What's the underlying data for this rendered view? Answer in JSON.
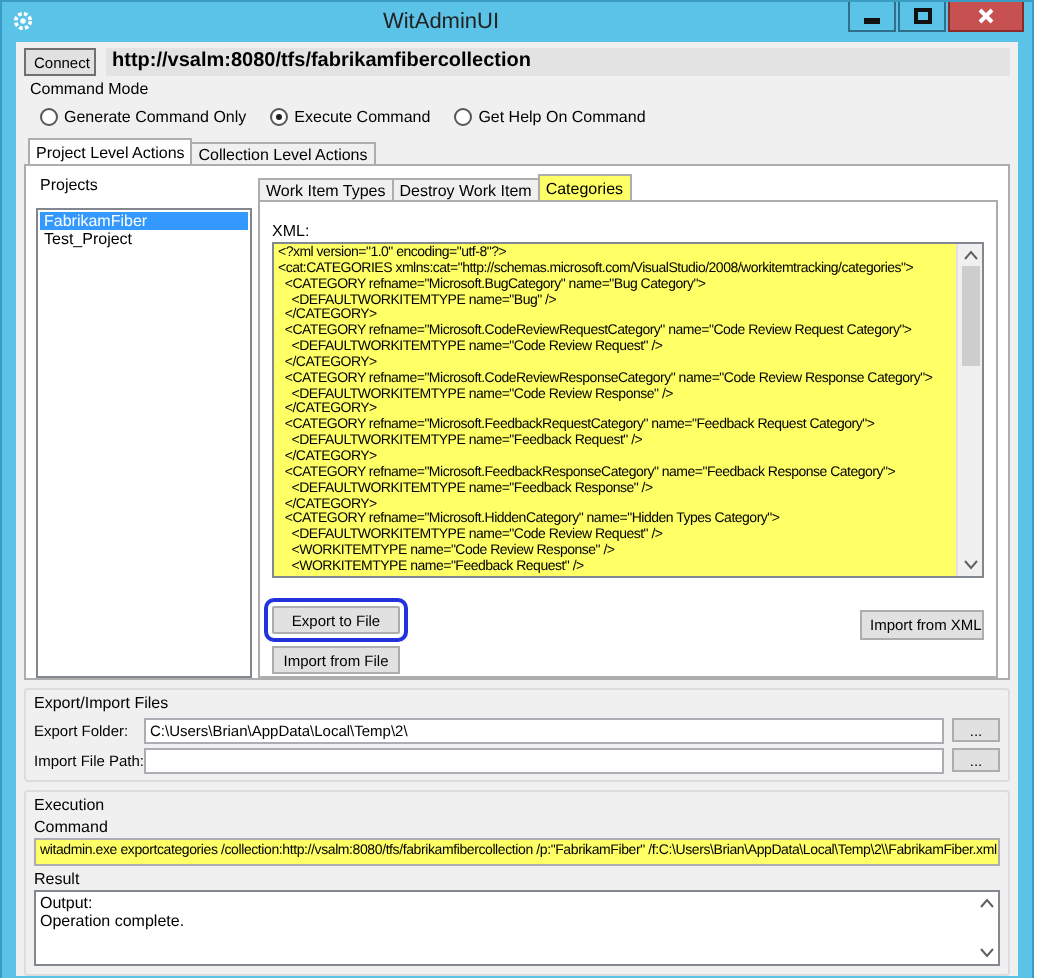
{
  "window": {
    "title": "WitAdminUI"
  },
  "connection": {
    "button": "Connect",
    "url": "http://vsalm:8080/tfs/fabrikamfibercollection"
  },
  "command_mode": {
    "label": "Command Mode",
    "options": [
      {
        "label": "Generate Command Only",
        "selected": false
      },
      {
        "label": "Execute Command",
        "selected": true
      },
      {
        "label": "Get Help On Command",
        "selected": false
      }
    ]
  },
  "tabs": [
    {
      "label": "Project Level Actions",
      "selected": true
    },
    {
      "label": "Collection Level Actions",
      "selected": false
    }
  ],
  "projects": {
    "label": "Projects",
    "items": [
      {
        "label": "FabrikamFiber",
        "selected": true
      },
      {
        "label": "Test_Project",
        "selected": false
      }
    ]
  },
  "inner_tabs": [
    {
      "label": "Work Item Types",
      "selected": false
    },
    {
      "label": "Destroy Work Item",
      "selected": false
    },
    {
      "label": "Categories",
      "selected": true
    }
  ],
  "xml": {
    "label": "XML:",
    "lines": [
      "<?xml version=\"1.0\" encoding=\"utf-8\"?>",
      "<cat:CATEGORIES xmlns:cat=\"http://schemas.microsoft.com/VisualStudio/2008/workitemtracking/categories\">",
      "  <CATEGORY refname=\"Microsoft.BugCategory\" name=\"Bug Category\">",
      "    <DEFAULTWORKITEMTYPE name=\"Bug\" />",
      "  </CATEGORY>",
      "  <CATEGORY refname=\"Microsoft.CodeReviewRequestCategory\" name=\"Code Review Request Category\">",
      "    <DEFAULTWORKITEMTYPE name=\"Code Review Request\" />",
      "  </CATEGORY>",
      "  <CATEGORY refname=\"Microsoft.CodeReviewResponseCategory\" name=\"Code Review Response Category\">",
      "    <DEFAULTWORKITEMTYPE name=\"Code Review Response\" />",
      "  </CATEGORY>",
      "  <CATEGORY refname=\"Microsoft.FeedbackRequestCategory\" name=\"Feedback Request Category\">",
      "    <DEFAULTWORKITEMTYPE name=\"Feedback Request\" />",
      "  </CATEGORY>",
      "  <CATEGORY refname=\"Microsoft.FeedbackResponseCategory\" name=\"Feedback Response Category\">",
      "    <DEFAULTWORKITEMTYPE name=\"Feedback Response\" />",
      "  </CATEGORY>",
      "  <CATEGORY refname=\"Microsoft.HiddenCategory\" name=\"Hidden Types Category\">",
      "    <DEFAULTWORKITEMTYPE name=\"Code Review Request\" />",
      "    <WORKITEMTYPE name=\"Code Review Response\" />",
      "    <WORKITEMTYPE name=\"Feedback Request\" />"
    ]
  },
  "buttons": {
    "export": {
      "label": "Export to File",
      "circled": true
    },
    "import_file": "Import from File",
    "import_xml": "Import from XML"
  },
  "files": {
    "label": "Export/Import Files",
    "rows": [
      {
        "label": "Export Folder:",
        "value": "C:\\Users\\Brian\\AppData\\Local\\Temp\\2\\",
        "browse": "..."
      },
      {
        "label": "Import File Path:",
        "value": "",
        "browse": "..."
      }
    ]
  },
  "execution": {
    "label": "Execution",
    "command_label": "Command",
    "command": "witadmin.exe exportcategories /collection:http://vsalm:8080/tfs/fabrikamfibercollection /p:\"FabrikamFiber\" /f:C:\\Users\\Brian\\AppData\\Local\\Temp\\2\\\\FabrikamFiber.xml",
    "result_label": "Result",
    "result_lines": [
      "Output:",
      "Operation complete."
    ]
  }
}
